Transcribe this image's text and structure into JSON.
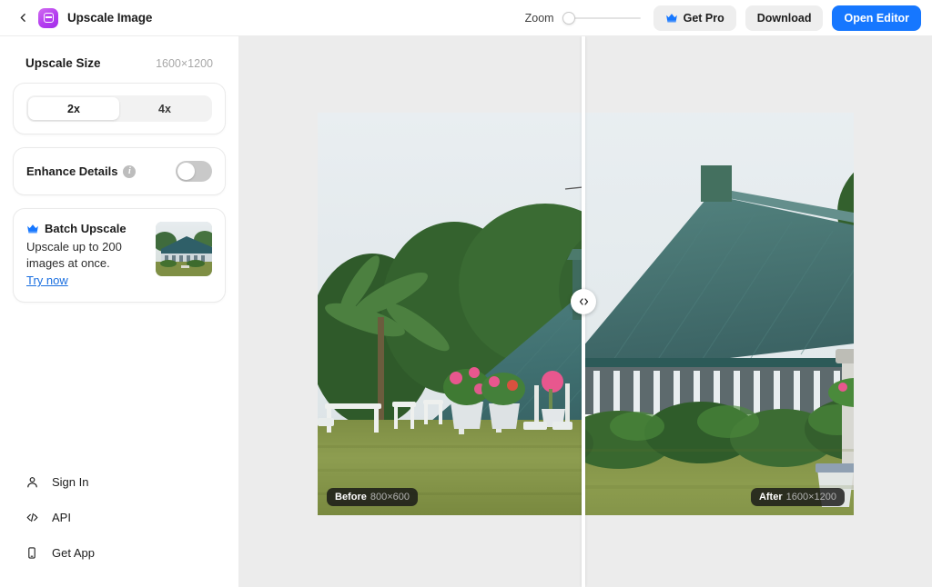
{
  "header": {
    "back_icon": "chevron-left-icon",
    "app_icon": "upscale-app-icon",
    "title": "Upscale Image",
    "zoom_label": "Zoom",
    "zoom_value": 0,
    "get_pro_label": "Get Pro",
    "get_pro_icon": "crown-icon",
    "download_label": "Download",
    "open_editor_label": "Open Editor"
  },
  "sidebar": {
    "upscale_size": {
      "label": "Upscale Size",
      "value": "1600×1200"
    },
    "scale_options": [
      {
        "label": "2x",
        "selected": true
      },
      {
        "label": "4x",
        "selected": false
      }
    ],
    "enhance_details": {
      "label": "Enhance Details",
      "info_icon": "info-icon",
      "info_glyph": "i",
      "enabled": false
    },
    "batch_upscale": {
      "icon": "crown-icon",
      "title": "Batch Upscale",
      "description": "Upscale up to 200 images at once.",
      "link_label": "Try now",
      "thumbnail_alt": "colonial-house-thumbnail"
    },
    "nav_items": [
      {
        "label": "Sign In",
        "icon": "user-icon"
      },
      {
        "label": "API",
        "icon": "code-icon"
      },
      {
        "label": "Get App",
        "icon": "mobile-icon"
      }
    ]
  },
  "canvas": {
    "compare_handle_icon": "compare-arrows-icon",
    "divider_position_pct": 49,
    "before": {
      "label": "Before",
      "dimensions": "800×600",
      "image_alt": "colonial-house-teal-roof-garden"
    },
    "after": {
      "label": "After",
      "dimensions": "1600×1200",
      "image_alt": "colonial-house-upscaled-bench-lawn"
    }
  },
  "colors": {
    "accent_blue": "#1677ff",
    "canvas_bg": "#ececec",
    "panel_bg": "#ffffff",
    "muted_text": "#a8a8a8",
    "link_blue": "#1a6fe0",
    "app_icon_purple": "#b43df0"
  }
}
